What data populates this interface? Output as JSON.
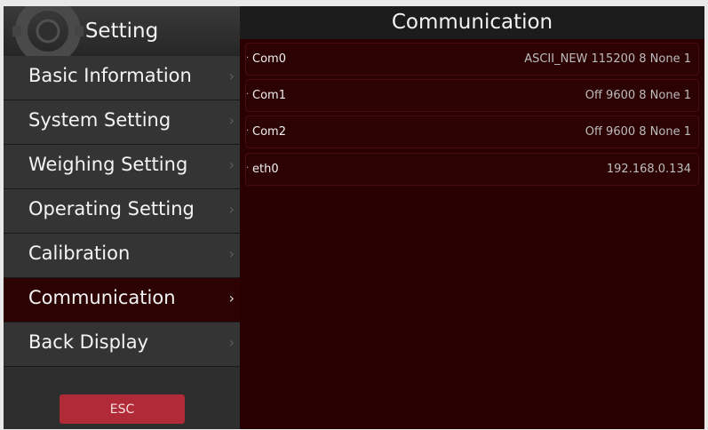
{
  "sidebar": {
    "title": "Setting",
    "items": [
      {
        "label": "Basic Information",
        "chevron": "›"
      },
      {
        "label": "System Setting",
        "chevron": "›"
      },
      {
        "label": "Weighing Setting",
        "chevron": "›"
      },
      {
        "label": "Operating Setting",
        "chevron": "›"
      },
      {
        "label": "Calibration",
        "chevron": "›"
      },
      {
        "label": "Communication",
        "chevron": "›",
        "active": true
      },
      {
        "label": "Back Display",
        "chevron": "›"
      }
    ],
    "esc_label": "ESC"
  },
  "main": {
    "title": "Communication",
    "bullet": "·",
    "rows": [
      {
        "name": "Com0",
        "value": "ASCII_NEW 115200 8 None 1"
      },
      {
        "name": "Com1",
        "value": "Off 9600 8 None 1"
      },
      {
        "name": "Com2",
        "value": "Off 9600 8 None 1"
      },
      {
        "name": "eth0",
        "value": "192.168.0.134"
      }
    ]
  },
  "colors": {
    "active_item": "#2d0203",
    "main_background": "#2a0102",
    "esc_button": "#b12a37"
  },
  "icons": {
    "header_decoration": "gear-icon",
    "menu_chevron": "chevron-right-icon"
  }
}
